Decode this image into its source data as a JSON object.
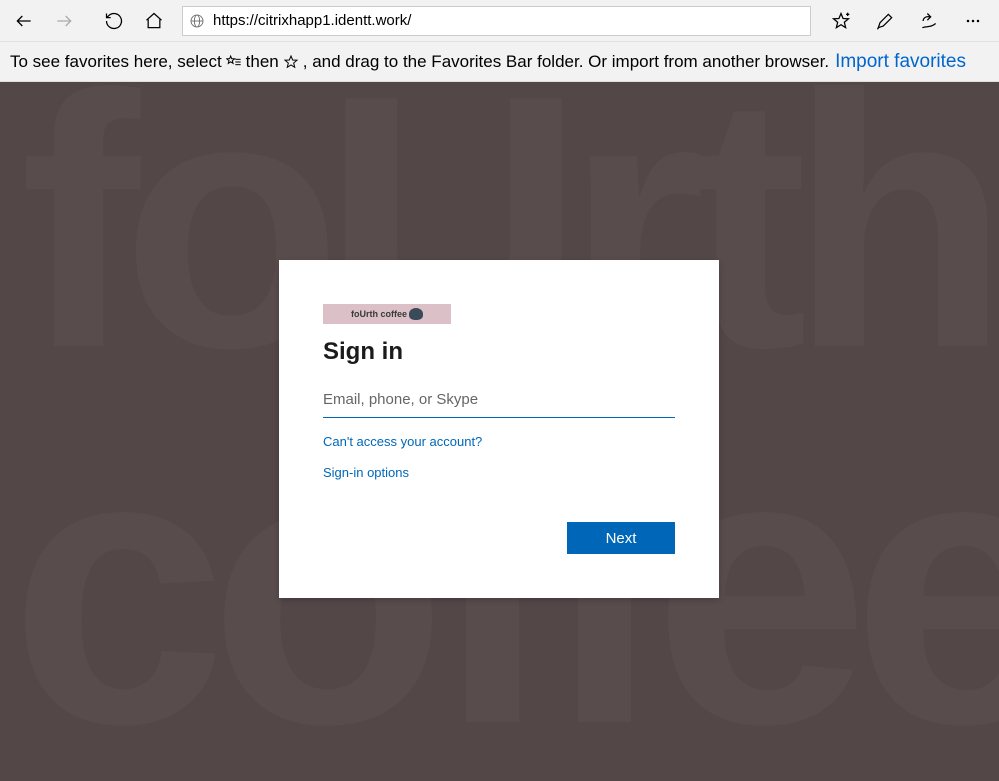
{
  "browser": {
    "url": "https://citrixhapp1.identt.work/",
    "favorites_text_before_first_icon": "To see favorites here, select",
    "favorites_text_between_icons": "then",
    "favorites_text_after_icons": ", and drag to the Favorites Bar folder. Or import from another browser.",
    "import_link_label": "Import favorites"
  },
  "signin": {
    "brand_text": "foUrth coffee",
    "title": "Sign in",
    "input_placeholder": "Email, phone, or Skype",
    "input_value": "",
    "cant_access_label": "Can't access your account?",
    "signin_options_label": "Sign-in options",
    "next_label": "Next"
  },
  "bg": {
    "top_text": "foUrth",
    "bottom_text": "coffee"
  }
}
